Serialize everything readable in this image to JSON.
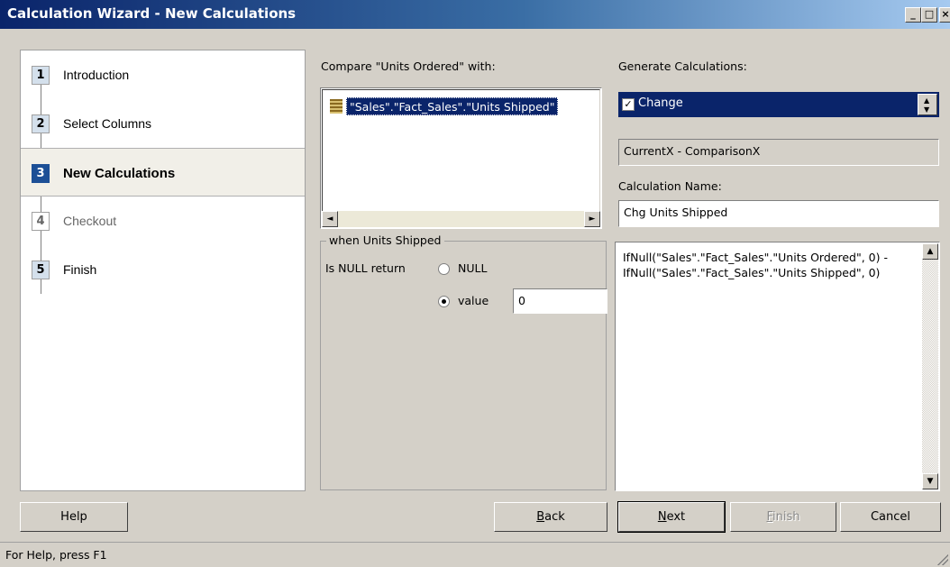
{
  "window": {
    "title": "Calculation Wizard - New Calculations",
    "minimize_glyph": "_",
    "maximize_glyph": "□",
    "close_glyph": "×"
  },
  "steps": [
    {
      "num": "1",
      "label": "Introduction",
      "state": "done"
    },
    {
      "num": "2",
      "label": "Select Columns",
      "state": "done"
    },
    {
      "num": "3",
      "label": "New Calculations",
      "state": "active"
    },
    {
      "num": "4",
      "label": "Checkout",
      "state": "pending"
    },
    {
      "num": "5",
      "label": "Finish",
      "state": "done"
    }
  ],
  "compare": {
    "label": "Compare \"Units Ordered\" with:",
    "items": [
      "\"Sales\".\"Fact_Sales\".\"Units Shipped\""
    ],
    "scroll_left_glyph": "◄",
    "scroll_right_glyph": "►"
  },
  "null_group": {
    "legend": "when Units Shipped",
    "is_null_label": "Is NULL return",
    "option_null": "NULL",
    "option_value": "value",
    "selected": "value",
    "value": "0"
  },
  "generate": {
    "label": "Generate Calculations:",
    "selected_option": "Change",
    "checked": true,
    "check_glyph": "✓",
    "spin_up_glyph": "▲",
    "spin_down_glyph": "▼",
    "formula_desc": "CurrentX - ComparisonX",
    "name_label": "Calculation Name:",
    "name_value": "Chg Units Shipped",
    "expression": "IfNull(\"Sales\".\"Fact_Sales\".\"Units Ordered\", 0) - IfNull(\"Sales\".\"Fact_Sales\".\"Units Shipped\", 0)",
    "scroll_up_glyph": "▲",
    "scroll_down_glyph": "▼"
  },
  "buttons": {
    "help": "Help",
    "back_accel": "B",
    "back_rest": "ack",
    "next_accel": "N",
    "next_rest": "ext",
    "finish_accel": "F",
    "finish_rest": "inish",
    "cancel": "Cancel"
  },
  "status": {
    "text": "For Help, press F1"
  },
  "colors": {
    "title_bar": "#0a246a",
    "selection": "#0a246a",
    "active_step": "#1c4f96",
    "face": "#d4d0c8"
  }
}
